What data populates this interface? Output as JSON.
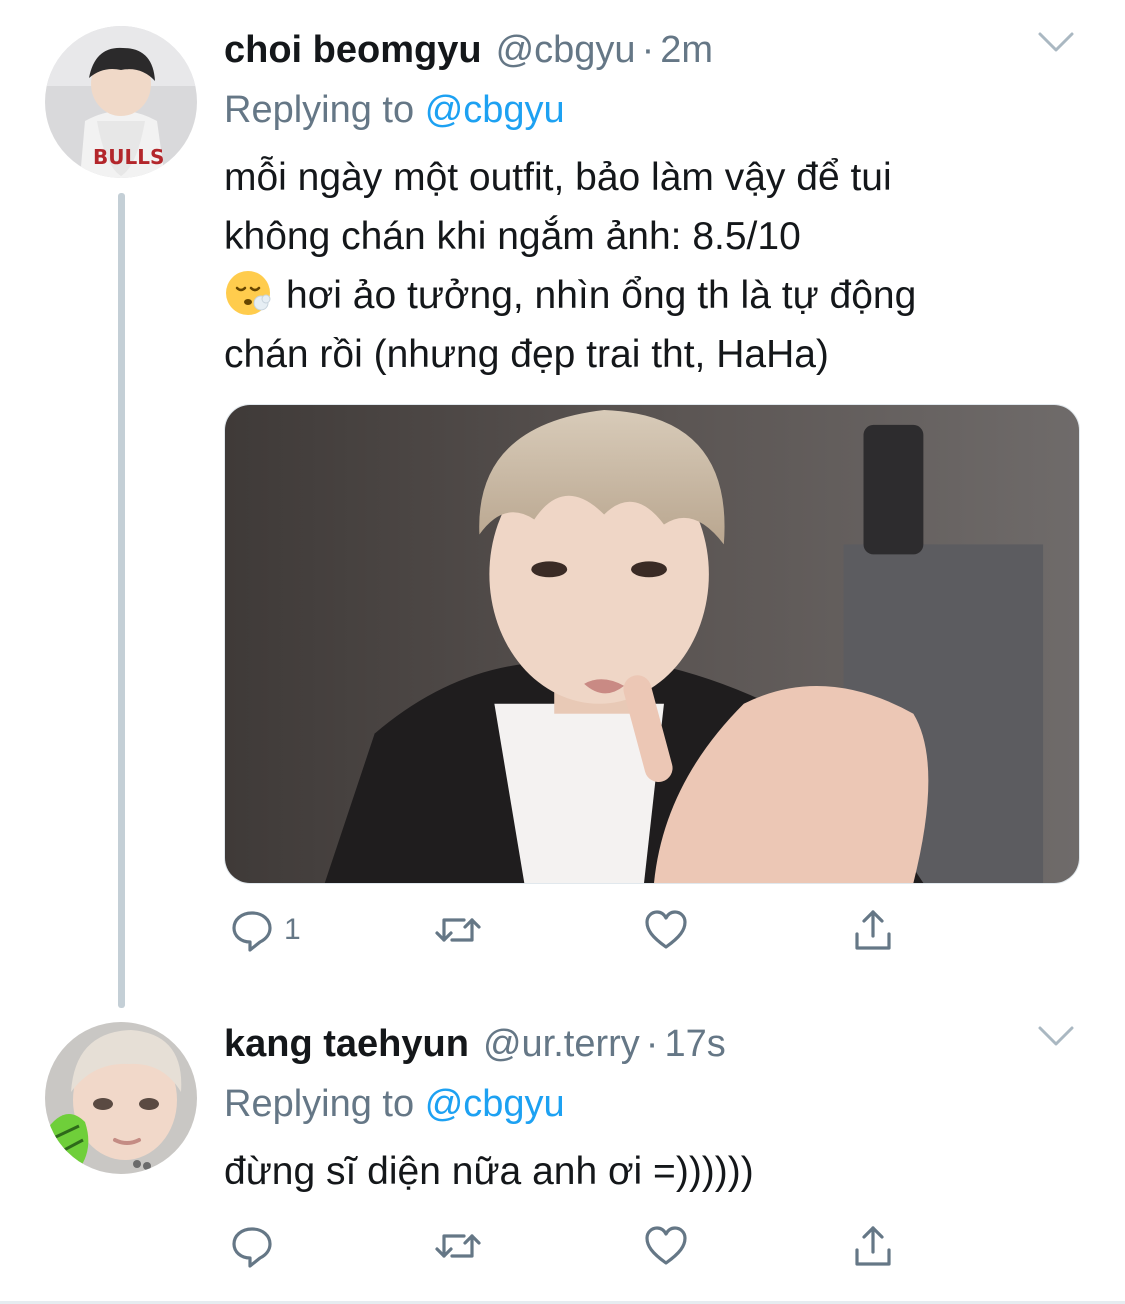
{
  "tweets": [
    {
      "name": "choi beomgyu",
      "handle": "@cbgyu",
      "separator": "·",
      "time": "2m",
      "replying_label": "Replying to",
      "replying_to": "@cbgyu",
      "text_lines": [
        "mỗi ngày một outfit, bảo làm vậy để tui",
        "không chán khi ngắm ảnh: 8.5/10",
        "hơi ảo tưởng, nhìn ổng th là tự động",
        "chán rồi (nhưng đẹp trai tht, HaHa)"
      ],
      "emoji": "😮‍💨",
      "reply_count": "1",
      "has_photo": true
    },
    {
      "name": "kang taehyun",
      "handle": "@ur.terry",
      "separator": "·",
      "time": "17s",
      "replying_label": "Replying to",
      "replying_to": "@cbgyu",
      "text_lines": [
        "đừng sĩ diện nữa anh ơi =))))))"
      ]
    }
  ],
  "icons": {
    "reply": "reply-icon",
    "retweet": "retweet-icon",
    "like": "heart-icon",
    "share": "share-icon",
    "menu": "chevron-down-icon"
  },
  "colors": {
    "text": "#14171a",
    "secondary": "#657786",
    "link": "#1da1f2",
    "thread_line": "#c4cfd6"
  }
}
